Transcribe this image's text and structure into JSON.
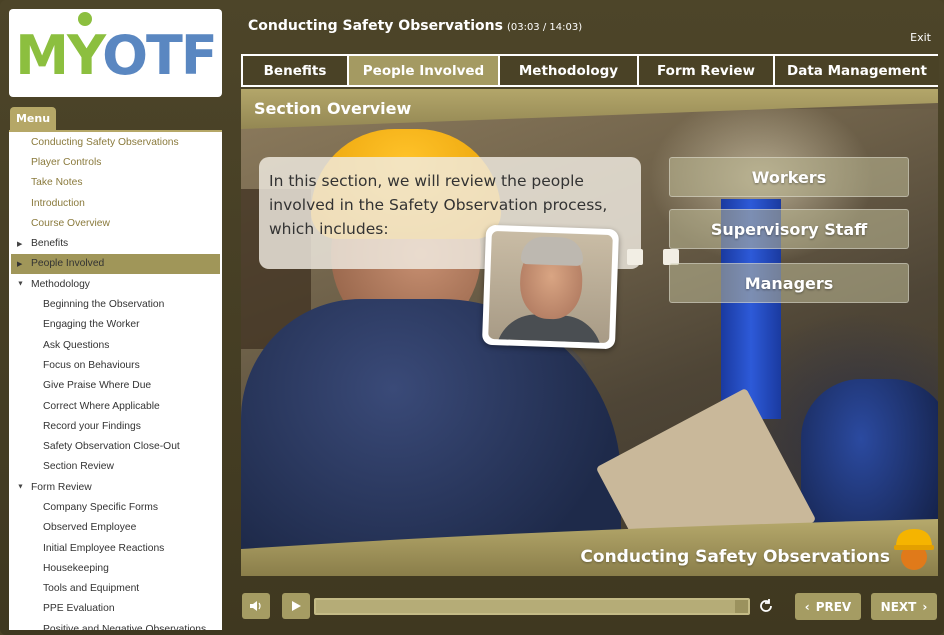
{
  "logo": {
    "part1": "M",
    "part2": "Y",
    "part3": "OTF"
  },
  "header": {
    "title": "Conducting Safety Observations",
    "time": "(03:03 / 14:03)",
    "exit_label": "Exit"
  },
  "menu": {
    "tab_label": "Menu",
    "items": [
      {
        "label": "Conducting Safety Observations",
        "level": 0
      },
      {
        "label": "Player Controls",
        "level": 0
      },
      {
        "label": "Take Notes",
        "level": 0
      },
      {
        "label": "Introduction",
        "level": 0
      },
      {
        "label": "Course Overview",
        "level": 0
      },
      {
        "label": "Benefits",
        "level": 0,
        "arrow": "▶"
      },
      {
        "label": "People Involved",
        "level": 0,
        "arrow": "▶",
        "active": true
      },
      {
        "label": "Methodology",
        "level": 0,
        "arrow": "▼"
      },
      {
        "label": "Beginning the Observation",
        "level": 1
      },
      {
        "label": "Engaging the Worker",
        "level": 1
      },
      {
        "label": "Ask Questions",
        "level": 1
      },
      {
        "label": "Focus on Behaviours",
        "level": 1
      },
      {
        "label": "Give Praise Where Due",
        "level": 1
      },
      {
        "label": "Correct Where Applicable",
        "level": 1
      },
      {
        "label": "Record your Findings",
        "level": 1
      },
      {
        "label": "Safety Observation Close-Out",
        "level": 1
      },
      {
        "label": "Section Review",
        "level": 1
      },
      {
        "label": "Form Review",
        "level": 0,
        "arrow": "▼"
      },
      {
        "label": "Company Specific Forms",
        "level": 1
      },
      {
        "label": "Observed Employee",
        "level": 1
      },
      {
        "label": "Initial Employee Reactions",
        "level": 1
      },
      {
        "label": "Housekeeping",
        "level": 1
      },
      {
        "label": "Tools and Equipment",
        "level": 1
      },
      {
        "label": "PPE Evaluation",
        "level": 1
      },
      {
        "label": "Positive and Negative Observations",
        "level": 1
      }
    ]
  },
  "tabs": [
    {
      "label": "Benefits"
    },
    {
      "label": "People Involved",
      "active": true
    },
    {
      "label": "Methodology"
    },
    {
      "label": "Form Review"
    },
    {
      "label": "Data Management"
    }
  ],
  "content": {
    "section_title": "Section Overview",
    "speech": "In this section, we will review the people involved in the Safety Observation process, which includes:",
    "options": [
      "Workers",
      "Supervisory Staff",
      "Managers"
    ],
    "footer_title": "Conducting Safety Observations"
  },
  "controls": {
    "progress": 0.97,
    "prev_label": "PREV",
    "next_label": "NEXT"
  },
  "colors": {
    "accent": "#a49a62",
    "frame": "#4a4226",
    "menu_text": "#8a7a3c"
  }
}
